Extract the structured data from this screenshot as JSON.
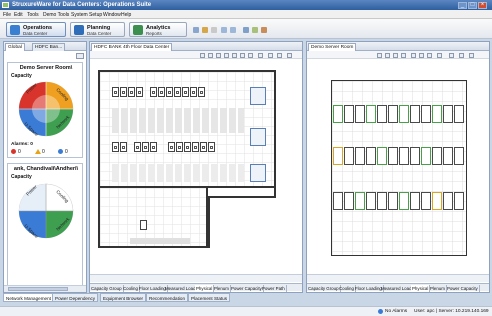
{
  "window": {
    "title": "StruxureWare for Data Centers: Operations Suite",
    "min": "_",
    "max": "□",
    "close": "×"
  },
  "menu": [
    "File",
    "Edit",
    "Tools",
    "Demo Tools",
    "System Setup",
    "Window",
    "Help"
  ],
  "modules": [
    {
      "title": "Operations",
      "sub": "Data Center",
      "color": "#3b7fd0"
    },
    {
      "title": "Planning",
      "sub": "Data Center",
      "color": "#2f6db8"
    },
    {
      "title": "Analytics",
      "sub": "Reports",
      "color": "#3d8f4f"
    }
  ],
  "left_panel": {
    "tabs": [
      "Global",
      "HDFC Ban..."
    ],
    "widgets": [
      {
        "title": "Demo Server Room\\",
        "capacity": "Capacity",
        "labels": [
          "Power",
          "Cooling",
          "U-Space",
          "Network"
        ],
        "alarms_label": "Alarms: 0",
        "counts": [
          "0",
          "0",
          "0"
        ]
      },
      {
        "title": "ank, Chandivali\\Andheri\\",
        "capacity": "Capacity",
        "labels": [
          "Power",
          "Cooling",
          "U-Space",
          "Network"
        ]
      }
    ]
  },
  "center_panel": {
    "tab": "HDFC BANK 4th Floor Data Center",
    "bottom_tabs": [
      "Capacity Group",
      "Cooling",
      "Floor Loading",
      "Measured Load",
      "Physical",
      "Plenum",
      "Power Capacity",
      "Power Path"
    ],
    "selected_tab": "Physical"
  },
  "right_panel": {
    "tab": "Demo Server Room",
    "bottom_tabs": [
      "Capacity Group",
      "Cooling",
      "Floor Loading",
      "Measured Load",
      "Physical",
      "Plenum",
      "Power Capacity"
    ],
    "selected_tab": "Physical"
  },
  "bottom_tabs": [
    "Network Management",
    "Power Dependency",
    "Equipment Browser",
    "Recommendation",
    "Placement Status"
  ],
  "status": {
    "alarms": "No Alarms",
    "user": "User: apc | Server: 10.219.140.169"
  },
  "colors": {
    "accent": "#2f5f9f",
    "alarm_red": "#d9342b",
    "alarm_warn": "#e8a317",
    "alarm_info": "#3a7bd5",
    "cooling": "#f0a020",
    "power": "#d9342b",
    "uspace": "#3a7bd5",
    "network": "#3d9f4f"
  }
}
